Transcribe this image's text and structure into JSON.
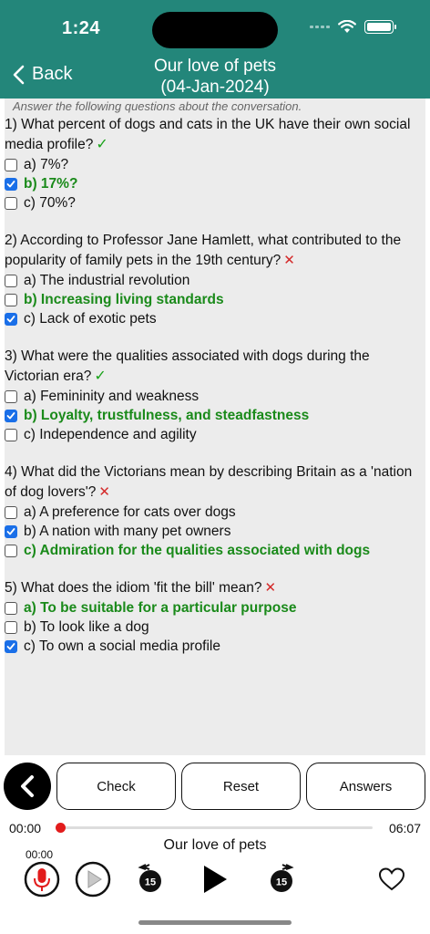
{
  "status": {
    "time": "1:24"
  },
  "nav": {
    "back_label": "Back",
    "title_line1": "Our love of pets",
    "title_line2": "(04-Jan-2024)"
  },
  "instructions": "Answer the following questions about the conversation.",
  "questions": [
    {
      "text": "1) What percent of dogs and cats in the UK have their own social media profile?",
      "result": "correct",
      "answers": [
        {
          "text": "a) 7%?",
          "checked": false,
          "correct": false
        },
        {
          "text": "b) 17%?",
          "checked": true,
          "correct": true
        },
        {
          "text": "c) 70%?",
          "checked": false,
          "correct": false
        }
      ]
    },
    {
      "text": "2) According to Professor Jane Hamlett, what contributed to the popularity of family pets in the 19th century?",
      "result": "wrong",
      "answers": [
        {
          "text": "a) The industrial revolution",
          "checked": false,
          "correct": false
        },
        {
          "text": "b) Increasing living standards",
          "checked": false,
          "correct": true
        },
        {
          "text": "c) Lack of exotic pets",
          "checked": true,
          "correct": false
        }
      ]
    },
    {
      "text": "3) What were the qualities associated with dogs during the Victorian era?",
      "result": "correct",
      "answers": [
        {
          "text": "a) Femininity and weakness",
          "checked": false,
          "correct": false
        },
        {
          "text": "b) Loyalty, trustfulness, and steadfastness",
          "checked": true,
          "correct": true
        },
        {
          "text": "c) Independence and agility",
          "checked": false,
          "correct": false
        }
      ]
    },
    {
      "text": "4) What did the Victorians mean by describing Britain as a 'nation of dog lovers'?",
      "result": "wrong",
      "answers": [
        {
          "text": "a) A preference for cats over dogs",
          "checked": false,
          "correct": false
        },
        {
          "text": "b) A nation with many pet owners",
          "checked": true,
          "correct": false
        },
        {
          "text": "c) Admiration for the qualities associated with dogs",
          "checked": false,
          "correct": true
        }
      ]
    },
    {
      "text": "5) What does the idiom 'fit the bill' mean?",
      "result": "wrong",
      "answers": [
        {
          "text": "a) To be suitable for a particular purpose",
          "checked": false,
          "correct": true
        },
        {
          "text": "b) To look like a dog",
          "checked": false,
          "correct": false
        },
        {
          "text": "c) To own a social media profile",
          "checked": true,
          "correct": false
        }
      ]
    }
  ],
  "buttons": {
    "check": "Check",
    "reset": "Reset",
    "answers": "Answers"
  },
  "player": {
    "current_time": "00:00",
    "total_time": "06:07",
    "track_title": "Our love of pets",
    "record_time": "00:00",
    "progress": 0.0,
    "skip_back_seconds": "15",
    "skip_forward_seconds": "15"
  },
  "colors": {
    "header": "#23867a",
    "correct_text": "#1a8a1a",
    "wrong_mark": "#d42a2a",
    "checkbox": "#1a6fe8",
    "progress_knob": "#e21c1c"
  }
}
